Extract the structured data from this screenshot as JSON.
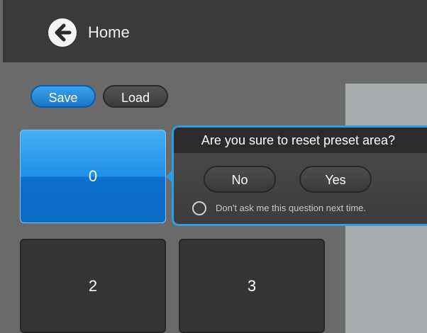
{
  "header": {
    "back_icon": "arrow-left-circle-icon",
    "title": "Home"
  },
  "toolbar": {
    "save_label": "Save",
    "load_label": "Load"
  },
  "presets": [
    {
      "label": "0",
      "selected": true
    },
    {
      "label": "2",
      "selected": false
    },
    {
      "label": "3",
      "selected": false
    }
  ],
  "dialog": {
    "title": "Are you sure to reset preset area?",
    "no_label": "No",
    "yes_label": "Yes",
    "dont_ask_label": "Don't ask me this question next time.",
    "dont_ask_checked": false
  },
  "colors": {
    "accent": "#2d9ee6",
    "header_bg": "#3a3a3a",
    "content_bg": "#6a6a6a"
  }
}
